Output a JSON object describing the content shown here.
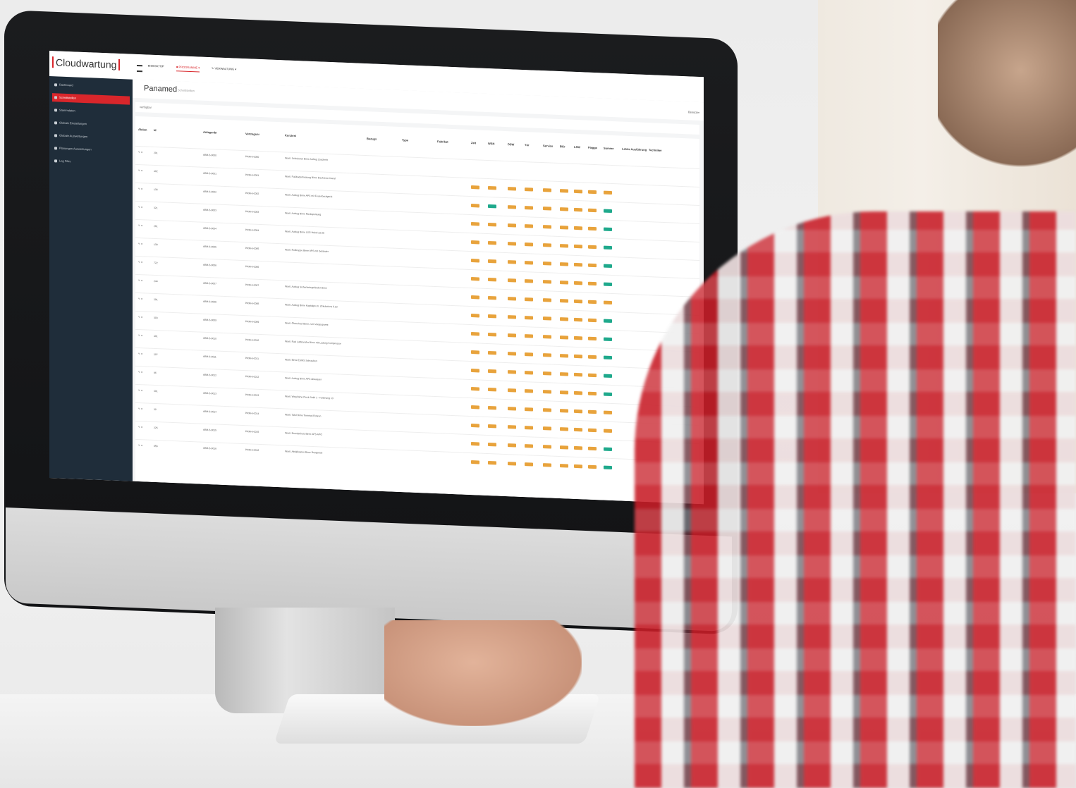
{
  "app": {
    "logo_text": "Cloudwartung",
    "nav_tabs": [
      "■ DESKTOP",
      "■ PROGRAMME ▾",
      "✎ VERWALTUNG ▾"
    ],
    "page_title": "Panamed",
    "page_subtitle": "Schnittstellen",
    "user_label": "Benutzer",
    "filter_text": "verfügbar"
  },
  "sidebar": {
    "items": [
      "Dashboard",
      "Schnittstellen",
      "Stammdaten",
      "Globale Einstellungen",
      "Globale Auswertungen",
      "Planungen Auswertungen",
      "Log Files"
    ],
    "active_index": 1
  },
  "table": {
    "headers": [
      "Aktion",
      "Id",
      "Anlagenbr",
      "Vertragsnr",
      "Kurztext",
      "Bezugs",
      "Type",
      "Fabrikat",
      "Zeit",
      "WSN",
      "DSW",
      "Tür",
      "Service",
      "BGr",
      "LSW",
      "Flagge",
      "Summe",
      "Letzte Ausführung",
      "Techniker"
    ],
    "rows": [
      {
        "id": "201",
        "anlage": "ABM-6-0000",
        "vertrag": "PRM-6-0000",
        "text": "Wartl. Schiebetür Birne Aufzug Zuschnitt",
        "badges": []
      },
      {
        "id": "402",
        "anlage": "ABM-6-0001",
        "vertrag": "PRM-6-0001",
        "text": "Wartl. Fußbodenheizung Birne Dachrinne Kanal",
        "badges": [
          "o",
          "o",
          "o",
          "o",
          "o",
          "o",
          "o",
          "o",
          "o"
        ]
      },
      {
        "id": "136",
        "anlage": "ABM-6-0002",
        "vertrag": "PRM-6-0002",
        "text": "Wartl. Aufzug Birne APS mit Feuerlöschgerät",
        "badges": [
          "o",
          "g",
          "o",
          "o",
          "o",
          "o",
          "o",
          "o",
          "g"
        ]
      },
      {
        "id": "321",
        "anlage": "ABM-6-0003",
        "vertrag": "PRM-6-0003",
        "text": "Wartl. Aufzug Birne Rückspeisung",
        "badges": [
          "o",
          "o",
          "o",
          "o",
          "o",
          "o",
          "o",
          "o",
          "g"
        ]
      },
      {
        "id": "261",
        "anlage": "ABM-6-0004",
        "vertrag": "PRM-6-0004",
        "text": "Wartl. Aufzug Birne LSG Hebel 22.06",
        "badges": [
          "o",
          "o",
          "o",
          "o",
          "o",
          "o",
          "o",
          "o",
          "g"
        ]
      },
      {
        "id": "138",
        "anlage": "ABM-6-0005",
        "vertrag": "PRM-6-0005",
        "text": "Wartl. Rolltreppe Birne APS mit Geländer",
        "badges": [
          "o",
          "o",
          "o",
          "o",
          "o",
          "o",
          "o",
          "o",
          "g"
        ]
      },
      {
        "id": "722",
        "anlage": "ABM-6-0006",
        "vertrag": "PRM-6-0006",
        "text": "",
        "badges": [
          "o",
          "o",
          "o",
          "o",
          "o",
          "o",
          "o",
          "o",
          "g"
        ]
      },
      {
        "id": "244",
        "anlage": "ABM-6-0007",
        "vertrag": "PRM-6-0007",
        "text": "Wartl. Aufzug Sicherheitsgeländer Birne",
        "badges": [
          "o",
          "o",
          "o",
          "o",
          "o",
          "o",
          "o",
          "o",
          "o"
        ]
      },
      {
        "id": "291",
        "anlage": "ABM-6-0008",
        "vertrag": "PRM-6-0008",
        "text": "Wartl. Aufzug Birne Kapitalpro 6. Zirkulations 6.13",
        "badges": [
          "o",
          "o",
          "o",
          "o",
          "o",
          "o",
          "o",
          "o",
          "g"
        ]
      },
      {
        "id": "303",
        "anlage": "ABM-6-0009",
        "vertrag": "PRM-6-0009",
        "text": "Wartl. Ölwechsel Birne zum Vorgespannt",
        "badges": [
          "o",
          "o",
          "o",
          "o",
          "o",
          "o",
          "o",
          "o",
          "g"
        ]
      },
      {
        "id": "401",
        "anlage": "ABM-6-0010",
        "vertrag": "PRM-6-0010",
        "text": "Wartl. Rad Lufttransfer Birne mit Ladung Kompressor",
        "badges": [
          "o",
          "o",
          "o",
          "o",
          "o",
          "o",
          "o",
          "o",
          "g"
        ]
      },
      {
        "id": "207",
        "anlage": "ABM-6-0011",
        "vertrag": "PRM-6-0011",
        "text": "Wartl. Birne ESWS Schrauben",
        "badges": [
          "o",
          "o",
          "o",
          "o",
          "o",
          "o",
          "o",
          "o",
          "g"
        ]
      },
      {
        "id": "96",
        "anlage": "ABM-6-0012",
        "vertrag": "PRM-6-0012",
        "text": "Wartl. Aufzug Birne APS Abwasser",
        "badges": [
          "o",
          "o",
          "o",
          "o",
          "o",
          "o",
          "o",
          "o",
          "g"
        ]
      },
      {
        "id": "301",
        "anlage": "ABM-6-0013",
        "vertrag": "PRM-6-0013",
        "text": "Wartl. Weg Birne Fleck Stahl 1 - Türbeweg 13",
        "badges": [
          "o",
          "o",
          "o",
          "o",
          "o",
          "o",
          "o",
          "o",
          "o"
        ]
      },
      {
        "id": "30",
        "anlage": "ABM-6-0014",
        "vertrag": "PRM-6-0014",
        "text": "Wartl. Tafel Birne Terminal Rohren",
        "badges": [
          "o",
          "o",
          "o",
          "o",
          "o",
          "o",
          "o",
          "o",
          "o"
        ]
      },
      {
        "id": "225",
        "anlage": "ABM-6-0015",
        "vertrag": "PRM-6-0015",
        "text": "Wartl. Brandschutz Birne APS APO",
        "badges": [
          "o",
          "o",
          "o",
          "o",
          "o",
          "o",
          "o",
          "o",
          "g"
        ]
      },
      {
        "id": "856",
        "anlage": "ABM-6-0016",
        "vertrag": "PRM-6-0016",
        "text": "Wartl. Abfallkasten Birne Baugeräte",
        "badges": [
          "o",
          "o",
          "o",
          "o",
          "o",
          "o",
          "o",
          "o",
          "g"
        ]
      }
    ]
  },
  "colors": {
    "brand_red": "#d9262b",
    "sidebar_bg": "#1f2d3a",
    "badge_orange": "#e8a33c",
    "badge_green": "#1fa98c"
  }
}
